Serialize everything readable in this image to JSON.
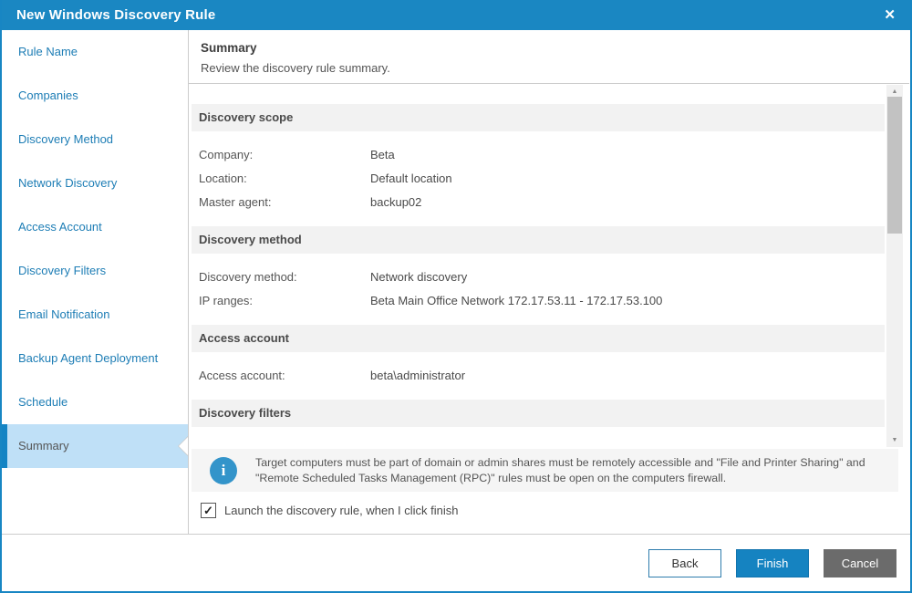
{
  "window": {
    "title": "New Windows Discovery Rule",
    "close_glyph": "✕"
  },
  "colors": {
    "accent_blue": "#1a87c2",
    "selected_item_bg": "#bfe0f7",
    "sidebar_link": "#1d7db5",
    "finish_button": "#1583c1",
    "cancel_button": "#6b6b6b",
    "section_band_bg": "#f2f2f2",
    "note_bg": "#f5f5f5"
  },
  "sidebar": {
    "items": [
      {
        "label": "Rule Name",
        "active": false
      },
      {
        "label": "Companies",
        "active": false
      },
      {
        "label": "Discovery Method",
        "active": false
      },
      {
        "label": "Network Discovery",
        "active": false
      },
      {
        "label": "Access Account",
        "active": false
      },
      {
        "label": "Discovery Filters",
        "active": false
      },
      {
        "label": "Email Notification",
        "active": false
      },
      {
        "label": "Backup Agent Deployment",
        "active": false
      },
      {
        "label": "Schedule",
        "active": false
      },
      {
        "label": "Summary",
        "active": true
      }
    ]
  },
  "header": {
    "title": "Summary",
    "subtitle": "Review the discovery rule summary."
  },
  "sections": [
    {
      "title": "Discovery scope",
      "rows": [
        {
          "label": "Company:",
          "value": "Beta"
        },
        {
          "label": "Location:",
          "value": "Default location"
        },
        {
          "label": "Master agent:",
          "value": "backup02"
        }
      ]
    },
    {
      "title": "Discovery method",
      "rows": [
        {
          "label": "Discovery method:",
          "value": "Network discovery"
        },
        {
          "label": "IP ranges:",
          "value": "Beta Main Office Network 172.17.53.11 - 172.17.53.100"
        }
      ]
    },
    {
      "title": "Access account",
      "rows": [
        {
          "label": "Access account:",
          "value": "beta\\administrator"
        }
      ]
    },
    {
      "title": "Discovery filters",
      "rows": []
    }
  ],
  "scrollbar": {
    "up_glyph": "▲",
    "down_glyph": "▼"
  },
  "note": {
    "icon_glyph": "i",
    "text": "Target computers must be part of domain or admin shares must be remotely accessible and \"File and Printer Sharing\" and \"Remote Scheduled Tasks Management (RPC)\" rules must be open on the computers firewall."
  },
  "checkbox": {
    "checked": true,
    "check_glyph": "✓",
    "label": "Launch the discovery rule, when I click finish"
  },
  "footer": {
    "back": "Back",
    "finish": "Finish",
    "cancel": "Cancel"
  }
}
